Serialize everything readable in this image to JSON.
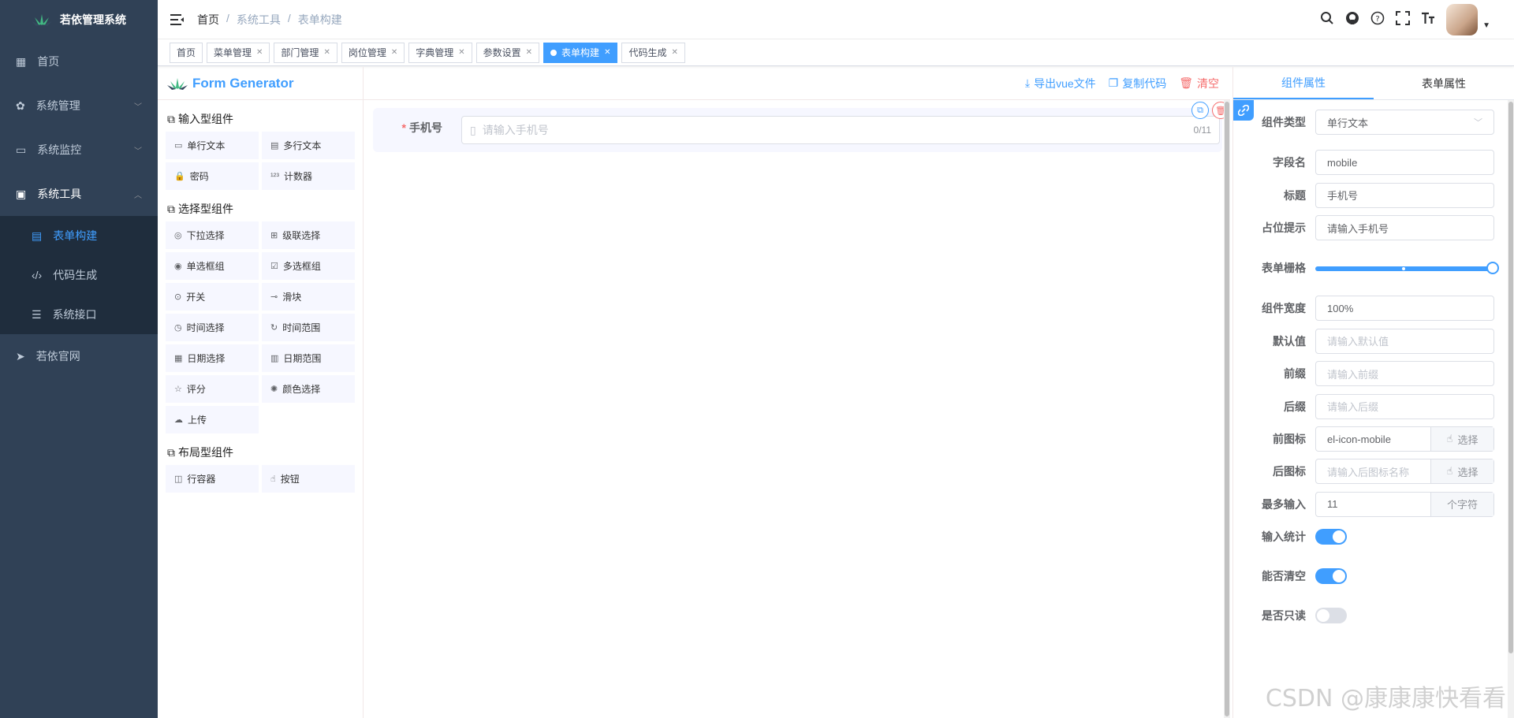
{
  "sidebar": {
    "title": "若依管理系统",
    "items": [
      {
        "label": "首页",
        "icon": "dashboard-icon"
      },
      {
        "label": "系统管理",
        "icon": "gear-icon"
      },
      {
        "label": "系统监控",
        "icon": "monitor-icon"
      },
      {
        "label": "系统工具",
        "icon": "toolbox-icon"
      },
      {
        "label": "若依官网",
        "icon": "paper-plane-icon"
      }
    ],
    "sub_items": [
      {
        "label": "表单构建",
        "icon": "grid-icon"
      },
      {
        "label": "代码生成",
        "icon": "code-icon"
      },
      {
        "label": "系统接口",
        "icon": "sliders-icon"
      }
    ]
  },
  "breadcrumb": [
    "首页",
    "系统工具",
    "表单构建"
  ],
  "tags": [
    "首页",
    "菜单管理",
    "部门管理",
    "岗位管理",
    "字典管理",
    "参数设置",
    "表单构建",
    "代码生成"
  ],
  "generator": {
    "title": "Form Generator",
    "groups": [
      {
        "title": "输入型组件",
        "items": [
          "单行文本",
          "多行文本",
          "密码",
          "计数器"
        ]
      },
      {
        "title": "选择型组件",
        "items": [
          "下拉选择",
          "级联选择",
          "单选框组",
          "多选框组",
          "开关",
          "滑块",
          "时间选择",
          "时间范围",
          "日期选择",
          "日期范围",
          "评分",
          "颜色选择",
          "上传"
        ]
      },
      {
        "title": "布局型组件",
        "items": [
          "行容器",
          "按钮"
        ]
      }
    ],
    "actions": {
      "export": "导出vue文件",
      "copy": "复制代码",
      "clear": "清空"
    },
    "field": {
      "label": "手机号",
      "placeholder": "请输入手机号",
      "count": "0/11"
    }
  },
  "props": {
    "tabs": [
      "组件属性",
      "表单属性"
    ],
    "rows": [
      {
        "label": "组件类型",
        "value": "单行文本",
        "placeholder": ""
      },
      {
        "label": "字段名",
        "value": "mobile",
        "placeholder": ""
      },
      {
        "label": "标题",
        "value": "手机号",
        "placeholder": ""
      },
      {
        "label": "占位提示",
        "value": "请输入手机号",
        "placeholder": ""
      },
      {
        "label": "表单栅格",
        "value": "",
        "placeholder": ""
      },
      {
        "label": "组件宽度",
        "value": "100%",
        "placeholder": ""
      },
      {
        "label": "默认值",
        "value": "",
        "placeholder": "请输入默认值"
      },
      {
        "label": "前缀",
        "value": "",
        "placeholder": "请输入前缀"
      },
      {
        "label": "后缀",
        "value": "",
        "placeholder": "请输入后缀"
      },
      {
        "label": "前图标",
        "value": "el-icon-mobile",
        "placeholder": "",
        "append": "选择"
      },
      {
        "label": "后图标",
        "value": "",
        "placeholder": "请输入后图标名称",
        "append": "选择"
      },
      {
        "label": "最多输入",
        "value": "11",
        "placeholder": "",
        "append": "个字符"
      },
      {
        "label": "输入统计",
        "switch": true
      },
      {
        "label": "能否清空",
        "switch": true
      },
      {
        "label": "是否只读",
        "switch": false
      }
    ],
    "grid_span": 24
  },
  "watermark": "CSDN @康康康快看看"
}
